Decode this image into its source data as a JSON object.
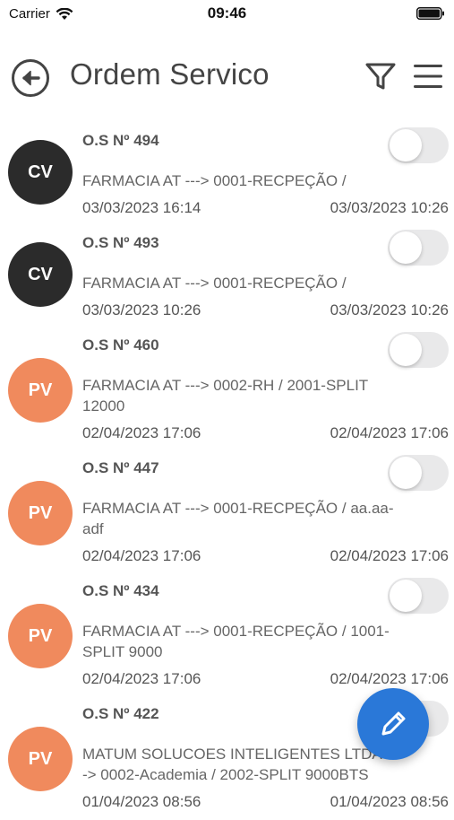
{
  "status_bar": {
    "carrier": "Carrier",
    "time": "09:46"
  },
  "header": {
    "title": "Ordem Servico"
  },
  "orders": [
    {
      "avatar": "CV",
      "avatar_color": "#2b2b2b",
      "title": "O.S Nº 494",
      "description": "FARMACIA AT ---> 0001-RECPEÇÃO /",
      "date_left": "03/03/2023 16:14",
      "date_right": "03/03/2023 10:26",
      "toggle_on": false
    },
    {
      "avatar": "CV",
      "avatar_color": "#2b2b2b",
      "title": "O.S Nº 493",
      "description": "FARMACIA AT ---> 0001-RECPEÇÃO /",
      "date_left": "03/03/2023 10:26",
      "date_right": "03/03/2023 10:26",
      "toggle_on": false
    },
    {
      "avatar": "PV",
      "avatar_color": "#f08a5d",
      "title": "O.S Nº 460",
      "description": "FARMACIA AT ---> 0002-RH / 2001-SPLIT 12000",
      "date_left": "02/04/2023 17:06",
      "date_right": "02/04/2023 17:06",
      "toggle_on": false
    },
    {
      "avatar": "PV",
      "avatar_color": "#f08a5d",
      "title": "O.S Nº 447",
      "description": "FARMACIA AT ---> 0001-RECPEÇÃO / aa.aa-adf",
      "date_left": "02/04/2023 17:06",
      "date_right": "02/04/2023 17:06",
      "toggle_on": false
    },
    {
      "avatar": "PV",
      "avatar_color": "#f08a5d",
      "title": "O.S Nº 434",
      "description": "FARMACIA AT ---> 0001-RECPEÇÃO / 1001-SPLIT 9000",
      "date_left": "02/04/2023 17:06",
      "date_right": "02/04/2023 17:06",
      "toggle_on": false
    },
    {
      "avatar": "PV",
      "avatar_color": "#f08a5d",
      "title": "O.S Nº 422",
      "description": "MATUM SOLUCOES INTELIGENTES LTDA ---> 0002-Academia / 2002-SPLIT 9000BTS",
      "date_left": "01/04/2023 08:56",
      "date_right": "01/04/2023 08:56",
      "toggle_on": false
    }
  ],
  "icons": {
    "back": "back-arrow-circle-icon",
    "filter": "filter-icon",
    "menu": "hamburger-menu-icon",
    "fab": "pencil-icon"
  },
  "colors": {
    "fab": "#2a78d8",
    "avatar_dark": "#2b2b2b",
    "avatar_orange": "#f08a5d"
  }
}
